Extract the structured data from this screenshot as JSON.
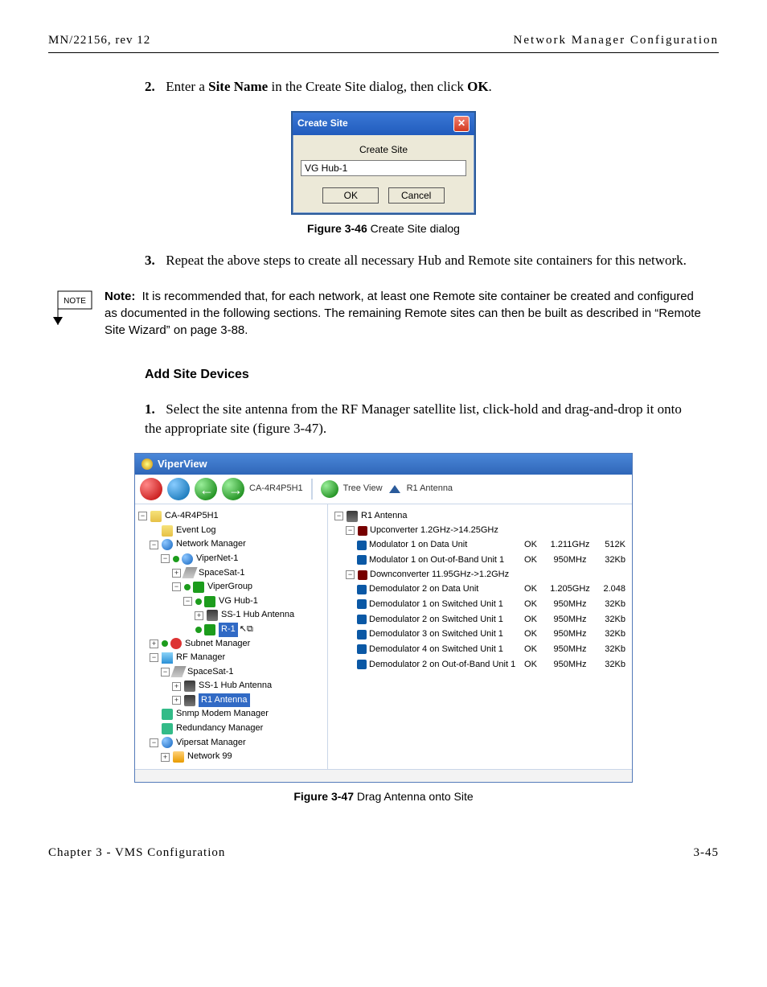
{
  "header": {
    "left": "MN/22156, rev 12",
    "right": "Network Manager Configuration"
  },
  "step2": {
    "num": "2.",
    "pre": "Enter a ",
    "bold1": "Site Name",
    "mid": " in the Create Site dialog, then click ",
    "bold2": "OK",
    "post": "."
  },
  "dialog": {
    "title": "Create Site",
    "label": "Create Site",
    "value": "VG Hub-1",
    "ok": "OK",
    "cancel": "Cancel"
  },
  "fig46": {
    "bold": "Figure 3-46",
    "text": "  Create Site dialog"
  },
  "step3": {
    "num": "3.",
    "text": "Repeat the above steps to create all necessary Hub and Remote site containers for this network."
  },
  "note": {
    "flag": "NOTE",
    "label": "Note:",
    "text": "It is recommended that, for each network, at least one Remote site container be created and configured as documented in the following sections. The remaining Remote sites can then be built as described in “Remote Site Wizard” on page 3-88."
  },
  "section": "Add Site Devices",
  "step1b": {
    "num": "1.",
    "text": "Select the site antenna from the RF Manager satellite list, click-hold and drag-and-drop it onto the appropriate site (figure 3-47)."
  },
  "vv": {
    "title": "ViperView",
    "crumb1": "CA-4R4P5H1",
    "crumb2": "Tree View",
    "crumb3": "R1 Antenna",
    "tree": {
      "root": "CA-4R4P5H1",
      "eventlog": "Event Log",
      "nm": "Network Manager",
      "vnet": "ViperNet-1",
      "ss1": "SpaceSat-1",
      "vg": "ViperGroup",
      "hub": "VG Hub-1",
      "hubant": "SS-1 Hub Antenna",
      "r1": "R-1",
      "subnet": "Subnet Manager",
      "rf": "RF Manager",
      "rfsat": "SpaceSat-1",
      "rfhub": "SS-1 Hub Antenna",
      "r1a": "R1 Antenna",
      "snmp": "Snmp Modem Manager",
      "redund": "Redundancy Manager",
      "vsm": "Vipersat Manager",
      "net99": "Network 99"
    },
    "list": {
      "root": "R1 Antenna",
      "up": "Upconverter 1.2GHz->14.25GHz",
      "down": "Downconverter 11.95GHz->1.2GHz",
      "rows": [
        {
          "name": "Modulator 1 on Data Unit",
          "s": "OK",
          "f": "1.211GHz",
          "r": "512K"
        },
        {
          "name": "Modulator 1 on Out-of-Band Unit 1",
          "s": "OK",
          "f": "950MHz",
          "r": "32Kb"
        },
        {
          "name": "Demodulator 2 on Data Unit",
          "s": "OK",
          "f": "1.205GHz",
          "r": "2.048"
        },
        {
          "name": "Demodulator 1 on Switched Unit 1",
          "s": "OK",
          "f": "950MHz",
          "r": "32Kb"
        },
        {
          "name": "Demodulator 2 on Switched Unit 1",
          "s": "OK",
          "f": "950MHz",
          "r": "32Kb"
        },
        {
          "name": "Demodulator 3 on Switched Unit 1",
          "s": "OK",
          "f": "950MHz",
          "r": "32Kb"
        },
        {
          "name": "Demodulator 4 on Switched Unit 1",
          "s": "OK",
          "f": "950MHz",
          "r": "32Kb"
        },
        {
          "name": "Demodulator 2 on Out-of-Band Unit 1",
          "s": "OK",
          "f": "950MHz",
          "r": "32Kb"
        }
      ]
    }
  },
  "fig47": {
    "bold": "Figure 3-47",
    "text": "  Drag Antenna onto Site"
  },
  "footer": {
    "left": "Chapter 3 - VMS Configuration",
    "right": "3-45"
  }
}
